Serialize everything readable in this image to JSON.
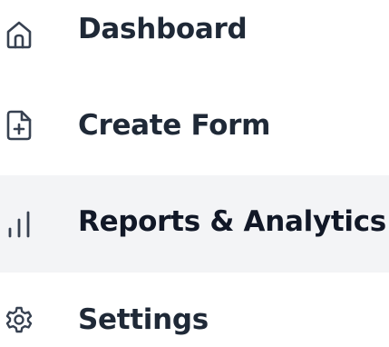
{
  "sidebar": {
    "items": [
      {
        "label": "Dashboard",
        "icon": "home-icon",
        "active": false
      },
      {
        "label": "Create Form",
        "icon": "file-plus-icon",
        "active": false
      },
      {
        "label": "Reports & Analytics",
        "icon": "bar-chart-icon",
        "active": true
      },
      {
        "label": "Settings",
        "icon": "gear-icon",
        "active": false
      }
    ],
    "colors": {
      "active_background": "#f3f4f6",
      "icon": "#374151",
      "text": "#1f2937"
    }
  }
}
